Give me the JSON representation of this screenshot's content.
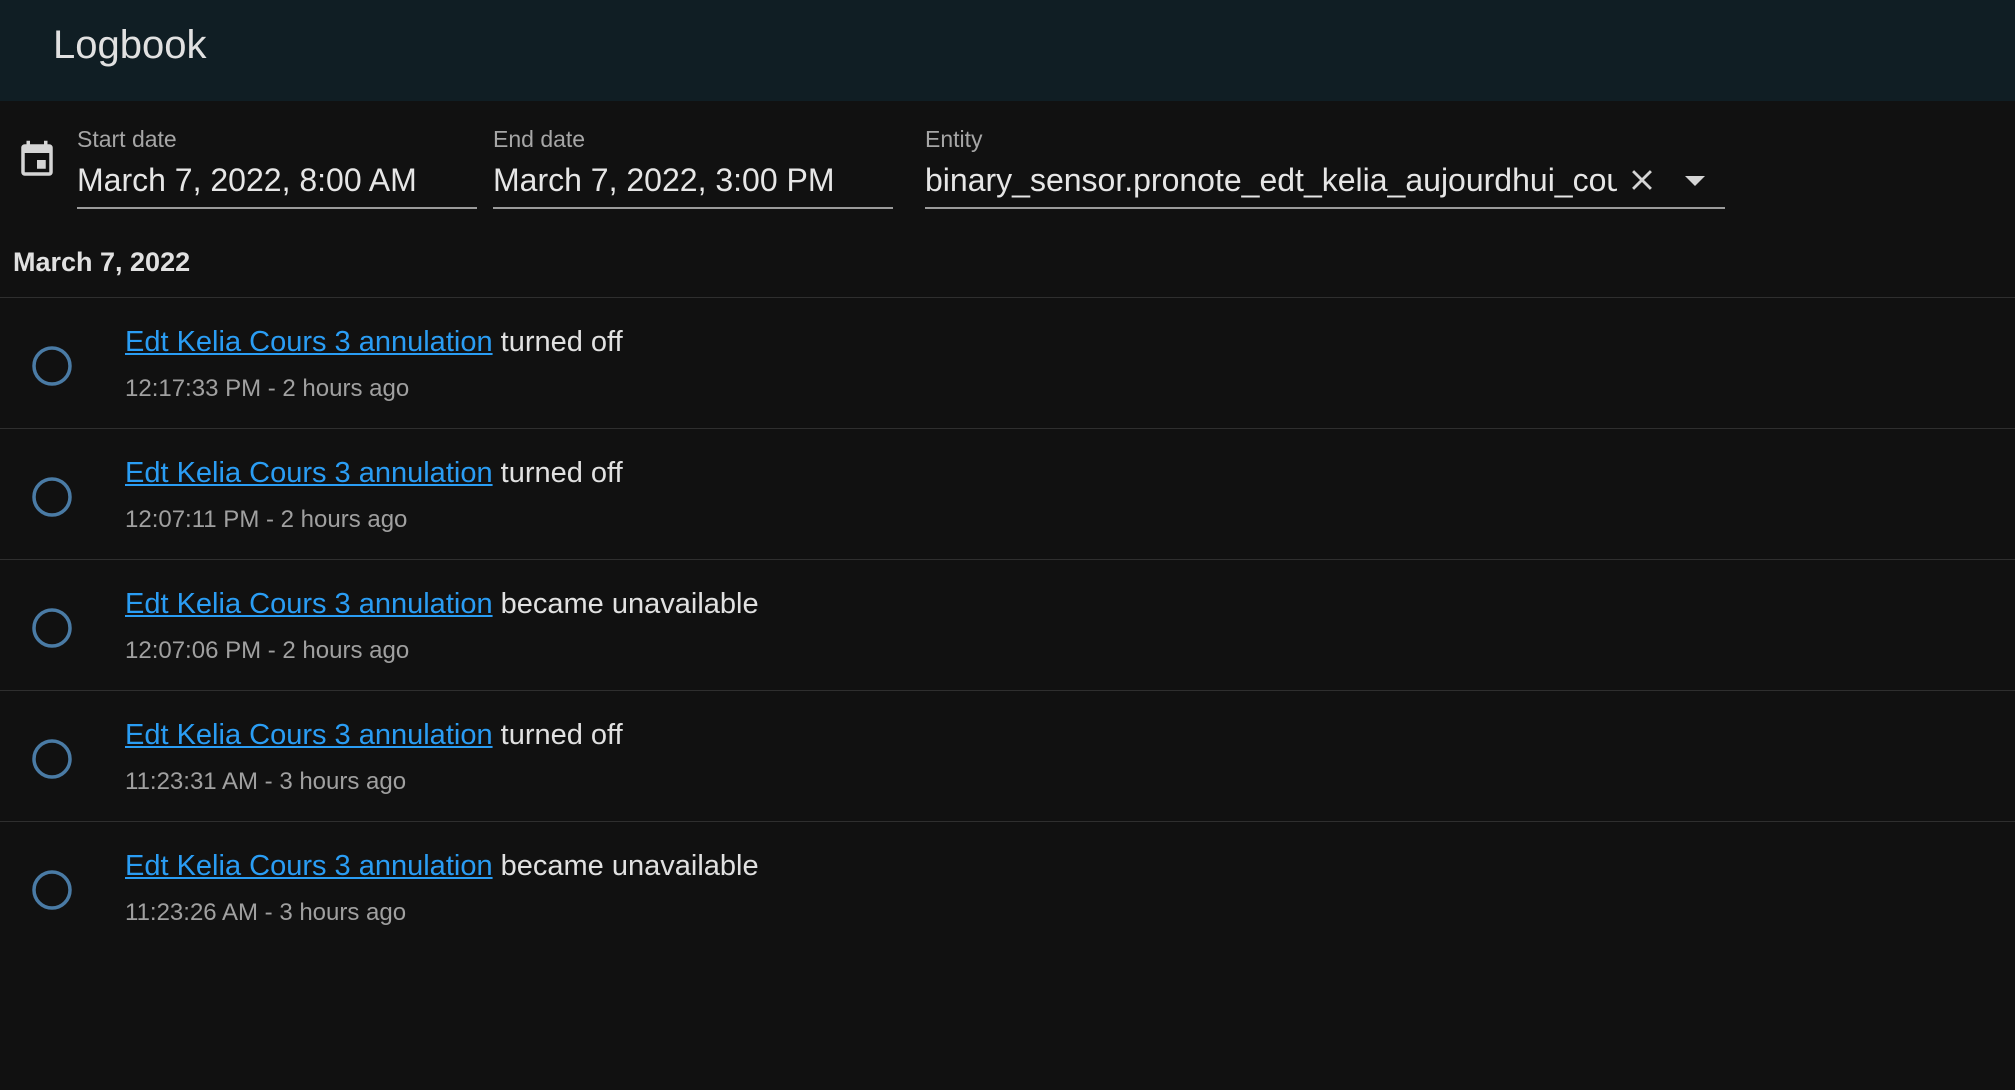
{
  "header": {
    "title": "Logbook"
  },
  "filters": {
    "start": {
      "label": "Start date",
      "value": "March 7, 2022, 8:00 AM"
    },
    "end": {
      "label": "End date",
      "value": "March 7, 2022, 3:00 PM"
    },
    "entity": {
      "label": "Entity",
      "value": "binary_sensor.pronote_edt_kelia_aujourdhui_cou"
    },
    "icons": {
      "calendar": "calendar-icon",
      "clear": "close-icon",
      "dropdown": "menu-down-icon"
    }
  },
  "date_heading": "March 7, 2022",
  "entries": [
    {
      "entity": "Edt Kelia Cours 3 annulation",
      "action": "turned off",
      "time": "12:17:33 PM - 2 hours ago",
      "icon": "circle-outline-icon"
    },
    {
      "entity": "Edt Kelia Cours 3 annulation",
      "action": "turned off",
      "time": "12:07:11 PM - 2 hours ago",
      "icon": "circle-outline-icon"
    },
    {
      "entity": "Edt Kelia Cours 3 annulation",
      "action": "became unavailable",
      "time": "12:07:06 PM - 2 hours ago",
      "icon": "circle-outline-icon"
    },
    {
      "entity": "Edt Kelia Cours 3 annulation",
      "action": "turned off",
      "time": "11:23:31 AM - 3 hours ago",
      "icon": "circle-outline-icon"
    },
    {
      "entity": "Edt Kelia Cours 3 annulation",
      "action": "became unavailable",
      "time": "11:23:26 AM - 3 hours ago",
      "icon": "circle-outline-icon"
    }
  ],
  "colors": {
    "header_bg": "#101e24",
    "page_bg": "#111111",
    "link": "#2a9df4",
    "icon": "#4a7ba5",
    "divider": "#2f2f2f"
  }
}
